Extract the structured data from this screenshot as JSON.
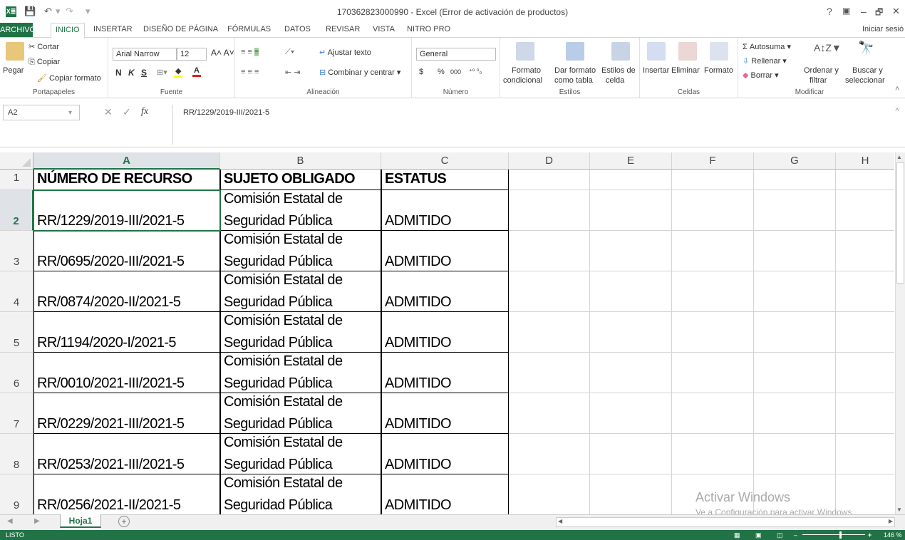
{
  "titlebar": {
    "title": "170362823000990 - Excel (Error de activación de productos)",
    "app_icon": "X≣",
    "help": "?",
    "minimize": "–",
    "restore": "🗗",
    "close": "✕"
  },
  "tabs": {
    "file": "ARCHIVO",
    "home": "INICIO",
    "insert": "INSERTAR",
    "page_layout": "DISEÑO DE PÁGINA",
    "formulas": "FÓRMULAS",
    "data": "DATOS",
    "review": "REVISAR",
    "view": "VISTA",
    "nitro": "NITRO PRO",
    "signin": "Iniciar sesió"
  },
  "ribbon": {
    "clipboard": {
      "paste": "Pegar",
      "cut": "Cortar",
      "copy": "Copiar",
      "format_painter": "Copiar formato",
      "label": "Portapapeles"
    },
    "font": {
      "name": "Arial Narrow",
      "size": "12",
      "bold": "N",
      "italic": "K",
      "underline": "S",
      "label": "Fuente"
    },
    "alignment": {
      "wrap": "Ajustar texto",
      "merge": "Combinar y centrar",
      "label": "Alineación"
    },
    "number": {
      "format": "General",
      "currency": "$",
      "percent": "%",
      "thousands": "000",
      "label": "Número"
    },
    "styles": {
      "conditional1": "Formato",
      "conditional2": "condicional",
      "table1": "Dar formato",
      "table2": "como tabla",
      "cell1": "Estilos de",
      "cell2": "celda",
      "label": "Estilos"
    },
    "cells": {
      "insert": "Insertar",
      "delete": "Eliminar",
      "format": "Formato",
      "label": "Celdas"
    },
    "editing": {
      "autosum": "Autosuma",
      "fill": "Rellenar",
      "clear": "Borrar",
      "sort1": "Ordenar y",
      "sort2": "filtrar",
      "find1": "Buscar y",
      "find2": "seleccionar",
      "label": "Modificar"
    }
  },
  "formula_bar": {
    "name_box": "A2",
    "fx": "fx",
    "value": "RR/1229/2019-III/2021-5"
  },
  "columns": [
    "A",
    "B",
    "C",
    "D",
    "E",
    "F",
    "G",
    "H"
  ],
  "headers": {
    "a": "NÚMERO DE RECURSO",
    "b": "SUJETO OBLIGADO",
    "c": "ESTATUS"
  },
  "rows": [
    {
      "n": "2",
      "a": "RR/1229/2019-III/2021-5",
      "b1": "Comisión Estatal de",
      "b2": "Seguridad Pública",
      "c": "ADMITIDO"
    },
    {
      "n": "3",
      "a": "RR/0695/2020-III/2021-5",
      "b1": "Comisión Estatal de",
      "b2": "Seguridad Pública",
      "c": "ADMITIDO"
    },
    {
      "n": "4",
      "a": "RR/0874/2020-II/2021-5",
      "b1": "Comisión Estatal de",
      "b2": "Seguridad Pública",
      "c": "ADMITIDO"
    },
    {
      "n": "5",
      "a": "RR/1194/2020-I/2021-5",
      "b1": "Comisión Estatal de",
      "b2": "Seguridad Pública",
      "c": "ADMITIDO"
    },
    {
      "n": "6",
      "a": "RR/0010/2021-III/2021-5",
      "b1": "Comisión Estatal de",
      "b2": "Seguridad Pública",
      "c": "ADMITIDO"
    },
    {
      "n": "7",
      "a": "RR/0229/2021-III/2021-5",
      "b1": "Comisión Estatal de",
      "b2": "Seguridad Pública",
      "c": "ADMITIDO"
    },
    {
      "n": "8",
      "a": "RR/0253/2021-III/2021-5",
      "b1": "Comisión Estatal de",
      "b2": "Seguridad Pública",
      "c": "ADMITIDO"
    },
    {
      "n": "9",
      "a": "RR/0256/2021-II/2021-5",
      "b1": "Comisión Estatal de",
      "b2": "Seguridad Pública",
      "c": "ADMITIDO"
    }
  ],
  "sheet": {
    "tab": "Hoja1",
    "add": "+"
  },
  "status": {
    "ready": "LISTO",
    "zoom": "146 %"
  },
  "watermark": {
    "line1": "Activar Windows",
    "line2": "Ve a Configuración para activar Windows."
  },
  "colors": {
    "accent": "#217346"
  }
}
